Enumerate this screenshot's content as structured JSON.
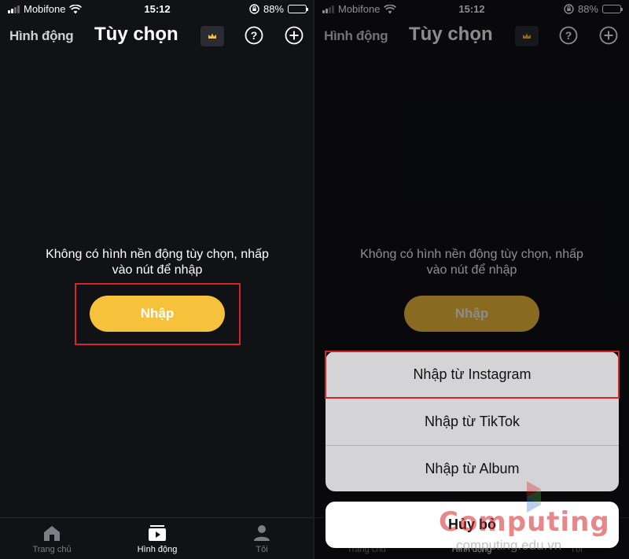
{
  "left_screen": {
    "status": {
      "carrier": "Mobifone",
      "time": "15:12",
      "battery": "88%",
      "battery_level": 0.88
    },
    "nav": {
      "back_title": "Hình động",
      "title": "Tùy chọn"
    },
    "empty_message_line1": "Không có hình nền động tùy chọn, nhấp",
    "empty_message_line2": "vào nút để nhập",
    "import_button": "Nhập",
    "tabs": [
      {
        "label": "Trang chủ",
        "icon": "home-icon",
        "active": false
      },
      {
        "label": "Hình động",
        "icon": "play-icon",
        "active": true
      },
      {
        "label": "Tôi",
        "icon": "person-icon",
        "active": false
      }
    ]
  },
  "right_screen": {
    "status": {
      "carrier": "Mobifone",
      "time": "15:12",
      "battery": "88%",
      "battery_level": 0.88
    },
    "nav": {
      "back_title": "Hình động",
      "title": "Tùy chọn"
    },
    "empty_message_line1": "Không có hình nền động tùy chọn, nhấp",
    "empty_message_line2": "vào nút để nhập",
    "import_button": "Nhập",
    "action_sheet": {
      "options": [
        "Nhập từ Instagram",
        "Nhập từ TikTok",
        "Nhập từ Album"
      ],
      "cancel": "Hủy bỏ"
    },
    "tabs": [
      {
        "label": "Trang chủ",
        "active": false
      },
      {
        "label": "Hình động",
        "active": true
      },
      {
        "label": "Tôi",
        "active": false
      }
    ]
  },
  "watermark": {
    "brand": "Computing",
    "url": "computing.edu.vn"
  },
  "colors": {
    "accent": "#f7c23b",
    "highlight": "#d3262a",
    "background": "#111216"
  }
}
